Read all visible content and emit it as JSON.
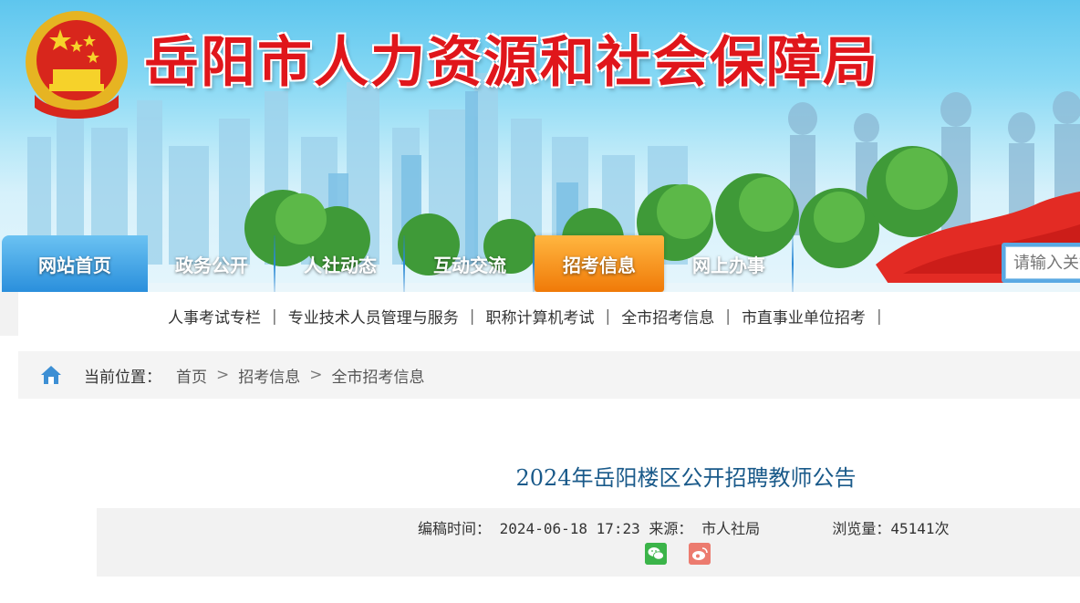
{
  "header": {
    "site_title": "岳阳市人力资源和社会保障局"
  },
  "nav": {
    "items": [
      {
        "label": "网站首页",
        "active": false
      },
      {
        "label": "政务公开",
        "active": false
      },
      {
        "label": "人社动态",
        "active": false
      },
      {
        "label": "互动交流",
        "active": false
      },
      {
        "label": "招考信息",
        "active": true
      },
      {
        "label": "网上办事",
        "active": false
      }
    ]
  },
  "search": {
    "placeholder": "请输入关键词"
  },
  "subnav": {
    "items": [
      "人事考试专栏",
      "专业技术人员管理与服务",
      "职称计算机考试",
      "全市招考信息",
      "市直事业单位招考"
    ],
    "separator": "|"
  },
  "breadcrumb": {
    "prefix": "当前位置：",
    "items": [
      "首页",
      "招考信息",
      "全市招考信息"
    ],
    "separator": ">"
  },
  "article": {
    "title": "2024年岳阳楼区公开招聘教师公告",
    "edit_time_label": "编稿时间：",
    "edit_time": "2024-06-18 17:23",
    "source_label": "来源：",
    "source": "市人社局",
    "views_label": "浏览量：",
    "views": "45141",
    "views_unit": "次"
  },
  "share": {
    "icons": [
      "wechat-icon",
      "weibo-icon"
    ]
  },
  "colors": {
    "title_red": "#e0161b",
    "nav_active": "#f28a1a",
    "nav_home": "#2a8fdc",
    "article_title": "#1a5a8a"
  }
}
